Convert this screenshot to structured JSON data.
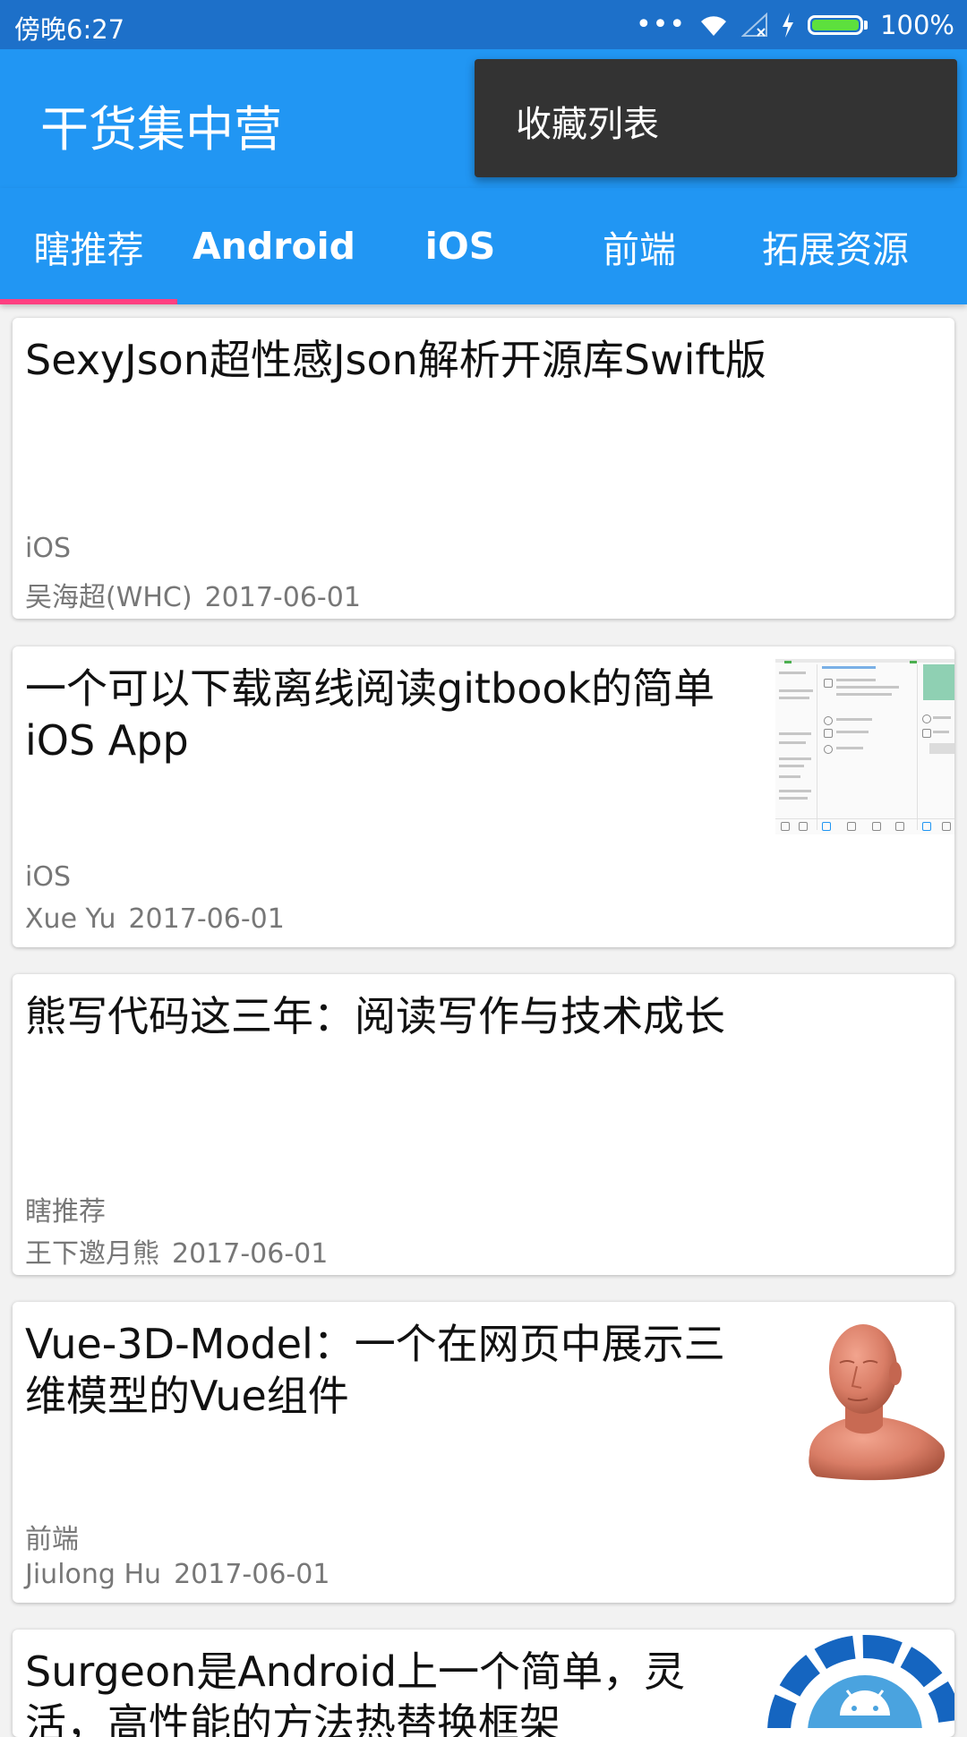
{
  "status_bar": {
    "time": "傍晚6:27",
    "battery_text": "100%",
    "battery_level": 1.0,
    "icons": [
      "more-dots-icon",
      "wifi-icon",
      "signal-icon",
      "charging-icon",
      "battery-icon"
    ]
  },
  "app_bar": {
    "title": "干货集中营",
    "menu_items": [
      "收藏列表"
    ]
  },
  "tabs": {
    "items": [
      "瞎推荐",
      "Android",
      "iOS",
      "前端",
      "拓展资源"
    ],
    "selected_index": 0,
    "indicator_color": "#ff4081"
  },
  "articles": [
    {
      "title": "SexyJson超性感Json解析开源库Swift版",
      "category": "iOS",
      "author": "吴海超(WHC)",
      "date": "2017-06-01",
      "thumbnail": "none"
    },
    {
      "title_line1": "一个可以下载离线阅读gitbook的简单",
      "title_line2": "iOS App",
      "category": "iOS",
      "author": "Xue Yu",
      "date": "2017-06-01",
      "thumbnail": "app-screenshot"
    },
    {
      "title": "熊写代码这三年：阅读写作与技术成长",
      "category": "瞎推荐",
      "author": "王下邀月熊",
      "date": "2017-06-01",
      "thumbnail": "none"
    },
    {
      "title_line1": "Vue-3D-Model：一个在网页中展示三",
      "title_line2": "维模型的Vue组件",
      "category": "前端",
      "author": "Jiulong Hu",
      "date": "2017-06-01",
      "thumbnail": "3d-head-model"
    },
    {
      "title_line1": "Surgeon是Android上一个简单，灵",
      "title_line2": "活，高性能的方法热替换框架",
      "thumbnail": "android-logo"
    }
  ],
  "colors": {
    "primary": "#2196f3",
    "status_bar": "#1d70c9",
    "accent": "#ff4081",
    "menu_bg": "#333333"
  }
}
